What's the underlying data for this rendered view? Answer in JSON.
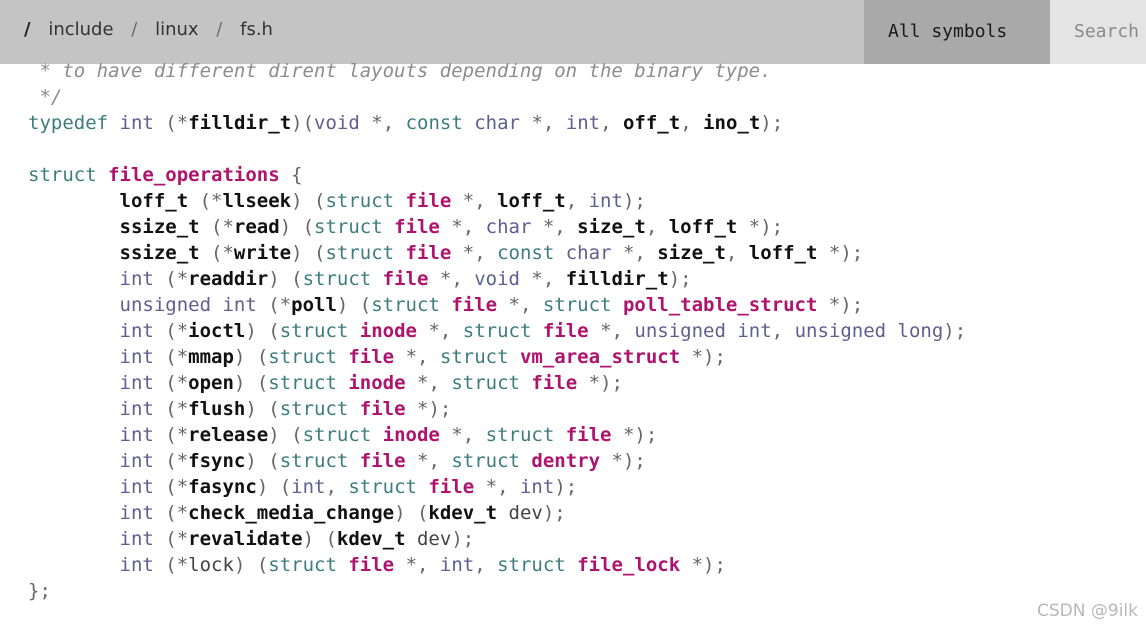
{
  "header": {
    "breadcrumb": {
      "root": "/",
      "items": [
        "include",
        "linux",
        "fs.h"
      ],
      "separator": "/"
    },
    "symbols_label": "All symbols",
    "search_placeholder": "Search"
  },
  "code": {
    "lines": [
      [
        [
          "com",
          " * to have different dirent layouts depending on the binary type."
        ]
      ],
      [
        [
          "com",
          " */"
        ]
      ],
      [
        [
          "kw",
          "typedef"
        ],
        [
          "p",
          " "
        ],
        [
          "type",
          "int"
        ],
        [
          "p",
          " ("
        ],
        [
          "p",
          "*"
        ],
        [
          "id",
          "filldir_t"
        ],
        [
          "p",
          ")("
        ],
        [
          "type",
          "void"
        ],
        [
          "p",
          " *, "
        ],
        [
          "kw",
          "const"
        ],
        [
          "p",
          " "
        ],
        [
          "type",
          "char"
        ],
        [
          "p",
          " *, "
        ],
        [
          "type",
          "int"
        ],
        [
          "p",
          ", "
        ],
        [
          "id",
          "off_t"
        ],
        [
          "p",
          ", "
        ],
        [
          "id",
          "ino_t"
        ],
        [
          "p",
          ");"
        ]
      ],
      [
        [
          "p",
          ""
        ]
      ],
      [
        [
          "kw",
          "struct"
        ],
        [
          "p",
          " "
        ],
        [
          "ref",
          "file_operations"
        ],
        [
          "p",
          " {"
        ]
      ],
      [
        [
          "p",
          "        "
        ],
        [
          "id",
          "loff_t"
        ],
        [
          "p",
          " (*"
        ],
        [
          "id",
          "llseek"
        ],
        [
          "p",
          ") ("
        ],
        [
          "kw",
          "struct"
        ],
        [
          "p",
          " "
        ],
        [
          "ref",
          "file"
        ],
        [
          "p",
          " *, "
        ],
        [
          "id",
          "loff_t"
        ],
        [
          "p",
          ", "
        ],
        [
          "type",
          "int"
        ],
        [
          "p",
          ");"
        ]
      ],
      [
        [
          "p",
          "        "
        ],
        [
          "id",
          "ssize_t"
        ],
        [
          "p",
          " (*"
        ],
        [
          "id",
          "read"
        ],
        [
          "p",
          ") ("
        ],
        [
          "kw",
          "struct"
        ],
        [
          "p",
          " "
        ],
        [
          "ref",
          "file"
        ],
        [
          "p",
          " *, "
        ],
        [
          "type",
          "char"
        ],
        [
          "p",
          " *, "
        ],
        [
          "id",
          "size_t"
        ],
        [
          "p",
          ", "
        ],
        [
          "id",
          "loff_t"
        ],
        [
          "p",
          " *);"
        ]
      ],
      [
        [
          "p",
          "        "
        ],
        [
          "id",
          "ssize_t"
        ],
        [
          "p",
          " (*"
        ],
        [
          "id",
          "write"
        ],
        [
          "p",
          ") ("
        ],
        [
          "kw",
          "struct"
        ],
        [
          "p",
          " "
        ],
        [
          "ref",
          "file"
        ],
        [
          "p",
          " *, "
        ],
        [
          "kw",
          "const"
        ],
        [
          "p",
          " "
        ],
        [
          "type",
          "char"
        ],
        [
          "p",
          " *, "
        ],
        [
          "id",
          "size_t"
        ],
        [
          "p",
          ", "
        ],
        [
          "id",
          "loff_t"
        ],
        [
          "p",
          " *);"
        ]
      ],
      [
        [
          "p",
          "        "
        ],
        [
          "type",
          "int"
        ],
        [
          "p",
          " (*"
        ],
        [
          "id",
          "readdir"
        ],
        [
          "p",
          ") ("
        ],
        [
          "kw",
          "struct"
        ],
        [
          "p",
          " "
        ],
        [
          "ref",
          "file"
        ],
        [
          "p",
          " *, "
        ],
        [
          "type",
          "void"
        ],
        [
          "p",
          " *, "
        ],
        [
          "id",
          "filldir_t"
        ],
        [
          "p",
          ");"
        ]
      ],
      [
        [
          "p",
          "        "
        ],
        [
          "type",
          "unsigned int"
        ],
        [
          "p",
          " (*"
        ],
        [
          "id",
          "poll"
        ],
        [
          "p",
          ") ("
        ],
        [
          "kw",
          "struct"
        ],
        [
          "p",
          " "
        ],
        [
          "ref",
          "file"
        ],
        [
          "p",
          " *, "
        ],
        [
          "kw",
          "struct"
        ],
        [
          "p",
          " "
        ],
        [
          "ref",
          "poll_table_struct"
        ],
        [
          "p",
          " *);"
        ]
      ],
      [
        [
          "p",
          "        "
        ],
        [
          "type",
          "int"
        ],
        [
          "p",
          " (*"
        ],
        [
          "id",
          "ioctl"
        ],
        [
          "p",
          ") ("
        ],
        [
          "kw",
          "struct"
        ],
        [
          "p",
          " "
        ],
        [
          "ref",
          "inode"
        ],
        [
          "p",
          " *, "
        ],
        [
          "kw",
          "struct"
        ],
        [
          "p",
          " "
        ],
        [
          "ref",
          "file"
        ],
        [
          "p",
          " *, "
        ],
        [
          "type",
          "unsigned int"
        ],
        [
          "p",
          ", "
        ],
        [
          "type",
          "unsigned long"
        ],
        [
          "p",
          ");"
        ]
      ],
      [
        [
          "p",
          "        "
        ],
        [
          "type",
          "int"
        ],
        [
          "p",
          " (*"
        ],
        [
          "id",
          "mmap"
        ],
        [
          "p",
          ") ("
        ],
        [
          "kw",
          "struct"
        ],
        [
          "p",
          " "
        ],
        [
          "ref",
          "file"
        ],
        [
          "p",
          " *, "
        ],
        [
          "kw",
          "struct"
        ],
        [
          "p",
          " "
        ],
        [
          "ref",
          "vm_area_struct"
        ],
        [
          "p",
          " *);"
        ]
      ],
      [
        [
          "p",
          "        "
        ],
        [
          "type",
          "int"
        ],
        [
          "p",
          " (*"
        ],
        [
          "id",
          "open"
        ],
        [
          "p",
          ") ("
        ],
        [
          "kw",
          "struct"
        ],
        [
          "p",
          " "
        ],
        [
          "ref",
          "inode"
        ],
        [
          "p",
          " *, "
        ],
        [
          "kw",
          "struct"
        ],
        [
          "p",
          " "
        ],
        [
          "ref",
          "file"
        ],
        [
          "p",
          " *);"
        ]
      ],
      [
        [
          "p",
          "        "
        ],
        [
          "type",
          "int"
        ],
        [
          "p",
          " (*"
        ],
        [
          "id",
          "flush"
        ],
        [
          "p",
          ") ("
        ],
        [
          "kw",
          "struct"
        ],
        [
          "p",
          " "
        ],
        [
          "ref",
          "file"
        ],
        [
          "p",
          " *);"
        ]
      ],
      [
        [
          "p",
          "        "
        ],
        [
          "type",
          "int"
        ],
        [
          "p",
          " (*"
        ],
        [
          "id",
          "release"
        ],
        [
          "p",
          ") ("
        ],
        [
          "kw",
          "struct"
        ],
        [
          "p",
          " "
        ],
        [
          "ref",
          "inode"
        ],
        [
          "p",
          " *, "
        ],
        [
          "kw",
          "struct"
        ],
        [
          "p",
          " "
        ],
        [
          "ref",
          "file"
        ],
        [
          "p",
          " *);"
        ]
      ],
      [
        [
          "p",
          "        "
        ],
        [
          "type",
          "int"
        ],
        [
          "p",
          " (*"
        ],
        [
          "id",
          "fsync"
        ],
        [
          "p",
          ") ("
        ],
        [
          "kw",
          "struct"
        ],
        [
          "p",
          " "
        ],
        [
          "ref",
          "file"
        ],
        [
          "p",
          " *, "
        ],
        [
          "kw",
          "struct"
        ],
        [
          "p",
          " "
        ],
        [
          "ref",
          "dentry"
        ],
        [
          "p",
          " *);"
        ]
      ],
      [
        [
          "p",
          "        "
        ],
        [
          "type",
          "int"
        ],
        [
          "p",
          " (*"
        ],
        [
          "id",
          "fasync"
        ],
        [
          "p",
          ") ("
        ],
        [
          "type",
          "int"
        ],
        [
          "p",
          ", "
        ],
        [
          "kw",
          "struct"
        ],
        [
          "p",
          " "
        ],
        [
          "ref",
          "file"
        ],
        [
          "p",
          " *, "
        ],
        [
          "type",
          "int"
        ],
        [
          "p",
          ");"
        ]
      ],
      [
        [
          "p",
          "        "
        ],
        [
          "type",
          "int"
        ],
        [
          "p",
          " (*"
        ],
        [
          "id",
          "check_media_change"
        ],
        [
          "p",
          ") ("
        ],
        [
          "id",
          "kdev_t"
        ],
        [
          "p",
          " "
        ],
        [
          "plain",
          "dev"
        ],
        [
          "p",
          ");"
        ]
      ],
      [
        [
          "p",
          "        "
        ],
        [
          "type",
          "int"
        ],
        [
          "p",
          " (*"
        ],
        [
          "id",
          "revalidate"
        ],
        [
          "p",
          ") ("
        ],
        [
          "id",
          "kdev_t"
        ],
        [
          "p",
          " "
        ],
        [
          "plain",
          "dev"
        ],
        [
          "p",
          ");"
        ]
      ],
      [
        [
          "p",
          "        "
        ],
        [
          "type",
          "int"
        ],
        [
          "p",
          " (*"
        ],
        [
          "plain",
          "lock"
        ],
        [
          "p",
          ") ("
        ],
        [
          "kw",
          "struct"
        ],
        [
          "p",
          " "
        ],
        [
          "ref",
          "file"
        ],
        [
          "p",
          " *, "
        ],
        [
          "type",
          "int"
        ],
        [
          "p",
          ", "
        ],
        [
          "kw",
          "struct"
        ],
        [
          "p",
          " "
        ],
        [
          "ref",
          "file_lock"
        ],
        [
          "p",
          " *);"
        ]
      ],
      [
        [
          "p",
          "};"
        ]
      ]
    ]
  },
  "watermark": "CSDN @9ilk"
}
